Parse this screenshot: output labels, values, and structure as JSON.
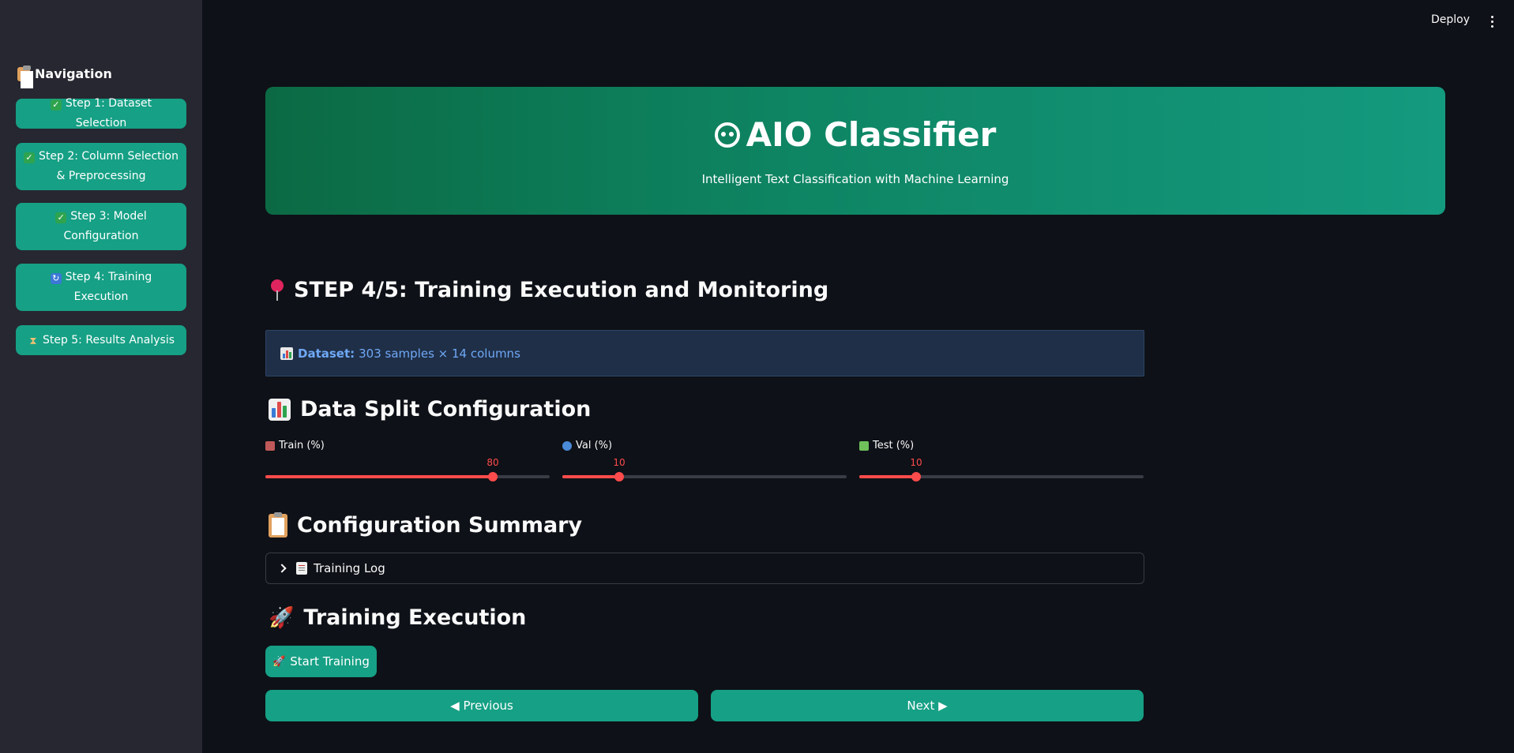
{
  "topbar": {
    "deploy_label": "Deploy"
  },
  "sidebar": {
    "title": "Navigation",
    "items": [
      {
        "icon": "check-icon",
        "label": "Step 1: Dataset Selection"
      },
      {
        "icon": "check-icon",
        "label": "Step 2: Column Selection & Preprocessing"
      },
      {
        "icon": "check-icon",
        "label": "Step 3: Model Configuration"
      },
      {
        "icon": "refresh-icon",
        "label": "Step 4: Training Execution"
      },
      {
        "icon": "hourglass-icon",
        "label": "Step 5: Results Analysis"
      }
    ]
  },
  "hero": {
    "title": "AIO Classifier",
    "subtitle": "Intelligent Text Classification with Machine Learning"
  },
  "step_heading": "STEP 4/5: Training Execution and Monitoring",
  "dataset_info": {
    "label": "Dataset:",
    "value": "303 samples × 14 columns"
  },
  "data_split": {
    "heading": "Data Split Configuration",
    "sliders": [
      {
        "label": "Train (%)",
        "value": 80,
        "min": 0,
        "max": 100
      },
      {
        "label": "Val (%)",
        "value": 10,
        "min": 0,
        "max": 50
      },
      {
        "label": "Test (%)",
        "value": 10,
        "min": 0,
        "max": 50
      }
    ]
  },
  "config_summary": {
    "heading": "Configuration Summary",
    "expander_label": "Training Log"
  },
  "training_execution": {
    "heading": "Training Execution",
    "start_label": "Start Training"
  },
  "navigation": {
    "previous_label": "◀ Previous",
    "next_label": "Next ▶"
  },
  "colors": {
    "accent": "#16a085",
    "slider": "#ff4b4b",
    "background": "#0e1117",
    "sidebar": "#262730"
  }
}
